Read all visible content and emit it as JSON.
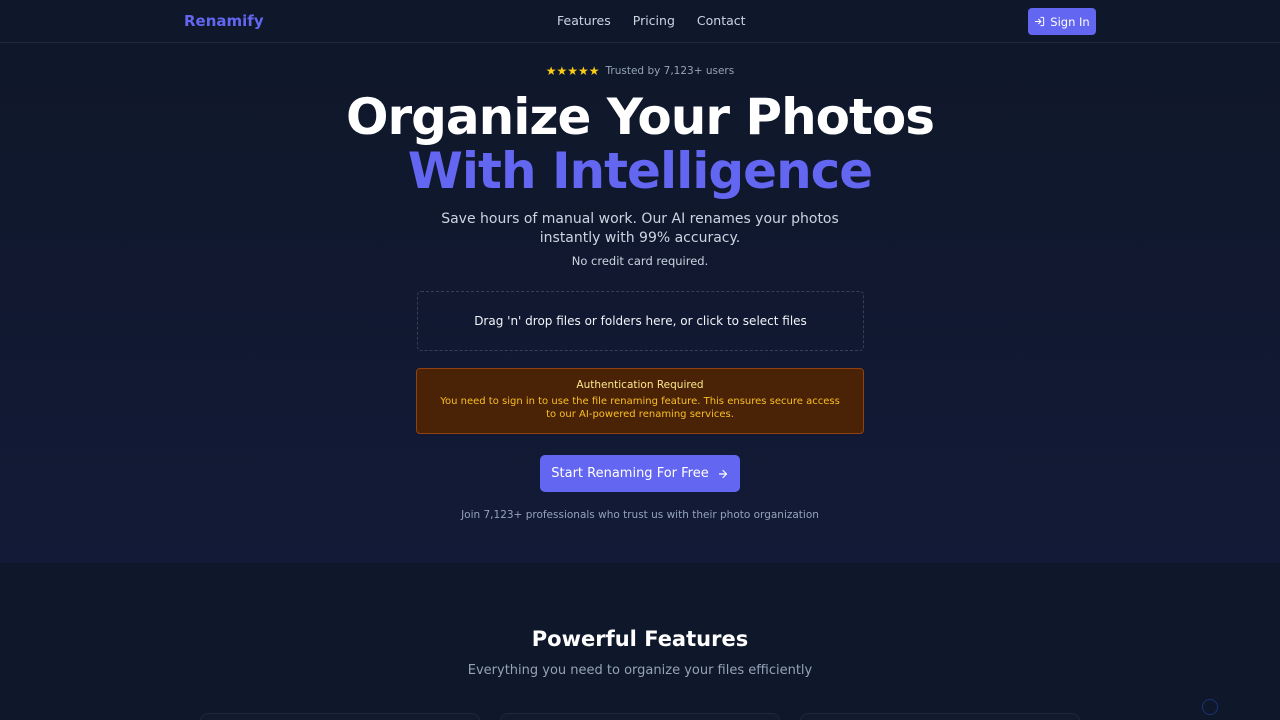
{
  "nav": {
    "brand": "Renamify",
    "links": [
      "Features",
      "Pricing",
      "Contact"
    ],
    "signin_label": "Sign In"
  },
  "hero": {
    "stars": "★★★★★",
    "trusted_text": "Trusted by 7,123+ users",
    "title_line1": "Organize Your Photos",
    "title_line2": "With Intelligence",
    "subtitle": "Save hours of manual work. Our AI renames your photos instantly with 99% accuracy.",
    "no_card": "No credit card required.",
    "dropzone_text": "Drag 'n' drop files or folders here, or click to select files",
    "alert": {
      "title": "Authentication Required",
      "message": "You need to sign in to use the file renaming feature. This ensures secure access to our AI-powered renaming services."
    },
    "cta_label": "Start Renaming For Free",
    "join_text": "Join 7,123+ professionals who trust us with their photo organization"
  },
  "features": {
    "title": "Powerful Features",
    "subtitle": "Everything you need to organize your files efficiently"
  },
  "colors": {
    "accent": "#6366f1",
    "background": "#0f172a",
    "warning_bg": "#4a2307",
    "warning_text": "#fbbf24"
  },
  "icons": {
    "signin": "login-icon",
    "cta": "arrow-right-icon",
    "rating": "star-icon"
  }
}
